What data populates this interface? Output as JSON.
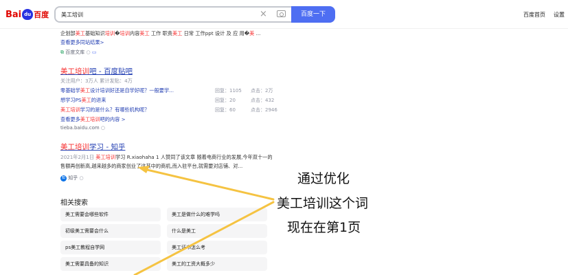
{
  "header": {
    "logo_bai": "Bai",
    "logo_du": "du",
    "logo_cn": "百度",
    "query": "美工培训",
    "search_btn": "百度一下",
    "links": [
      "百度首页",
      "设置"
    ]
  },
  "result1": {
    "snippet_parts": [
      "企划部",
      "美工",
      "基础知识",
      "培训",
      "�",
      "培训",
      "内容",
      "美工",
      " 工作 职责",
      "美工",
      " 日常 工作ppt 设计 及 应 用�",
      "美",
      " ..."
    ],
    "more": "查看更多同站结果>",
    "source": "百度文库"
  },
  "result2": {
    "title_hl": "美工培训",
    "title_rest": "吧 - 百度贴吧",
    "meta": "关注用户：3万人   累计发贴：4万",
    "rows": [
      {
        "parts": [
          "零基础学",
          "美工",
          "设计培训好还是自学好呢？一般要学..."
        ],
        "reply": "回复：1105",
        "click": "点击：2万"
      },
      {
        "parts": [
          "想学习PS",
          "美工",
          "的进来"
        ],
        "reply": "回复：20",
        "click": "点击：432"
      },
      {
        "parts": [
          "",
          "美工培训",
          "学习的是什么？有哪些机构呢？"
        ],
        "reply": "回复：60",
        "click": "点击：2946"
      }
    ],
    "more_parts": [
      "查看更多",
      "美工培训",
      "吧的内容 >"
    ],
    "source": "tieba.baidu.com"
  },
  "result3": {
    "title_hl": "美工培训",
    "title_rest": "学习 - 知乎",
    "line1_parts": [
      "2021年2月1日  ",
      "美工培训",
      "学习 R.xiaohaha 1 人赞同了该文章 随着电商行业的发展,今年双十一的"
    ],
    "line2": "售额再创新高,越来越多的商家创业了这其中的商机,而入驻平台,就需要对店铺、对...",
    "source": "知乎"
  },
  "related": {
    "title": "相关搜索",
    "items": [
      [
        "美工需要会哪些软件",
        "美工是做什么的难学吗"
      ],
      [
        "初级美工需要会什么",
        "什么是美工"
      ],
      [
        "ps美工教程自学网",
        "美工证书怎么考"
      ],
      [
        "美工需要具备的知识",
        "美工的工资大概多少"
      ]
    ]
  },
  "annotation": {
    "lines": [
      "通过优化",
      "美工培训这个词",
      "现在在第1页"
    ],
    "color": "#f5c342"
  }
}
